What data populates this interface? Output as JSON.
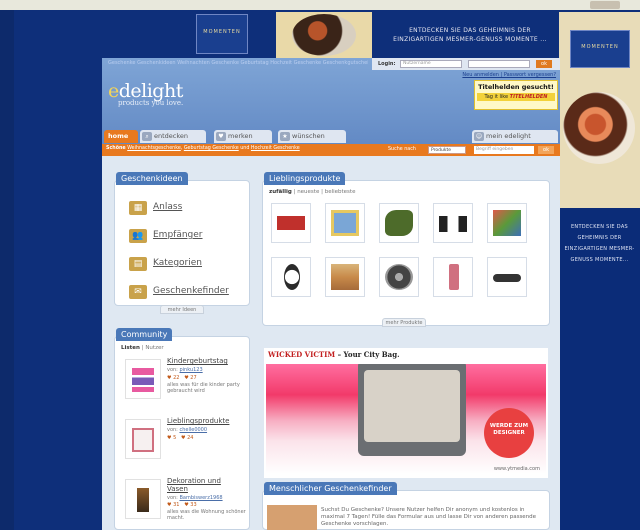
{
  "banner_top": {
    "brand": "MOMENTEN",
    "slogan": "ENTDECKEN SIE DAS GEHEIMNIS DER EINZIGARTIGEN MESMER-GENUSS MOMENTE ..."
  },
  "skyscraper": {
    "brand": "MOMENTEN",
    "text": "ENTDECKEN SIE DAS GEHEIMNIS DER EINZIGARTIGEN MESMER-GENUSS MOMENTE..."
  },
  "header": {
    "top_links": "Geschenke Geschenkideen Weihnachten Geschenke Geburtstag Hochzeit Geschenke Geschenkgutschein",
    "login_label": "Login:",
    "user_placeholder": "Nutzername",
    "login_ok": "ok",
    "register_link": "Neu anmelden | Passwort vergessen?",
    "logo_prefix": "e",
    "logo_rest": "delight",
    "tagline": "products you love.",
    "promo_title": "Titelhelden gesucht!",
    "promo_sub_prefix": "Tag it like",
    "promo_sub_brand": "TITELHELDEN"
  },
  "nav": {
    "tabs": [
      {
        "label": "home",
        "icon": "home"
      },
      {
        "label": "entdecken",
        "icon": "magnifier-icon"
      },
      {
        "label": "merken",
        "icon": "heart-icon"
      },
      {
        "label": "wünschen",
        "icon": "star-icon"
      },
      {
        "label": "mein edelight",
        "icon": "person-icon"
      }
    ],
    "subbar_prefix": "Schöne",
    "subbar_links": [
      "Weihnachtsgeschenke",
      "Geburtstag Geschenke",
      "Hochzeit Geschenke"
    ],
    "subbar_and": "und",
    "search_label": "Suche nach",
    "search_select": "Produkte",
    "search_placeholder": "Begriff eingeben",
    "search_ok": "ok"
  },
  "geschenkideen": {
    "title": "Geschenkideen",
    "items": [
      {
        "label": "Anlass",
        "icon": "calendar-icon"
      },
      {
        "label": "Empfänger",
        "icon": "people-icon"
      },
      {
        "label": "Kategorien",
        "icon": "grid-icon"
      },
      {
        "label": "Geschenkefinder",
        "icon": "gift-icon"
      }
    ],
    "more": "mehr Ideen"
  },
  "lieblingsprodukte": {
    "title": "Lieblingsprodukte",
    "filter_active": "zufällig",
    "filter_2": "neueste",
    "filter_3": "beliebteste",
    "more": "mehr Produkte",
    "products": [
      {
        "name": "sticker-pack",
        "color": "#c0302c"
      },
      {
        "name": "picture-book",
        "color": "#7aa6d6"
      },
      {
        "name": "green-stone",
        "color": "#4d6b2a"
      },
      {
        "name": "speakers",
        "color": "#222222"
      },
      {
        "name": "colorful-print",
        "color": "#5a9a3a"
      },
      {
        "name": "wrist-watch",
        "color": "#2b2b2b"
      },
      {
        "name": "painting",
        "color": "#c88a4a"
      },
      {
        "name": "round-disc",
        "color": "#444444"
      },
      {
        "name": "small-bottle",
        "color": "#d07080"
      },
      {
        "name": "sunglasses",
        "color": "#333333"
      }
    ]
  },
  "community": {
    "title": "Community",
    "tab_active": "Listen",
    "tab_2": "Nutzer",
    "items": [
      {
        "title": "Kindergeburtstag",
        "by": "von:",
        "user": "pinku123",
        "stat1": "22",
        "stat2": "27",
        "desc": "alles was für die kinder party gebraucht wird"
      },
      {
        "title": "Lieblingsprodukte",
        "by": "von:",
        "user": "chelle0000",
        "stat1": "5",
        "stat2": "24",
        "desc": ""
      },
      {
        "title": "Dekoration und Vasen",
        "by": "von:",
        "user": "Bambiswerz1968",
        "stat1": "31",
        "stat2": "33",
        "desc": "alles was die Wohnung schöner macht."
      }
    ]
  },
  "ad": {
    "title_red": "WICKED VICTIM",
    "title_black": " – Your City Bag.",
    "badge": "WERDE ZUM DESIGNER",
    "url": "www.ytmedia.com"
  },
  "finder": {
    "title": "Menschlicher Geschenkefinder",
    "text": "Suchst Du Geschenke? Unsere Nutzer helfen Dir anonym und kostenlos in maximal 7 Tagen! Fülle das Formular aus und lasse Dir von anderen passende Geschenke vorschlagen."
  }
}
